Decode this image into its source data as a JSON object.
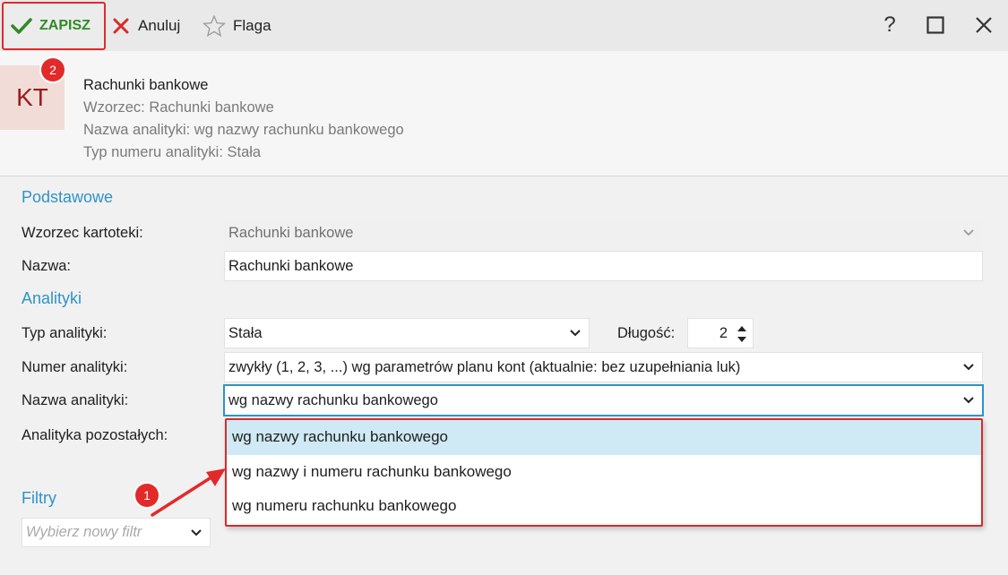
{
  "toolbar": {
    "save_label": "ZAPISZ",
    "cancel_label": "Anuluj",
    "flag_label": "Flaga",
    "help_label": "?"
  },
  "header": {
    "icon_text": "KT",
    "badge": "2",
    "title": "Rachunki bankowe",
    "template": "Wzorzec: Rachunki bankowe",
    "analytics_name": "Nazwa analityki: wg nazwy rachunku bankowego",
    "analytics_number_type": "Typ numeru analityki: Stała"
  },
  "sections": {
    "basic": "Podstawowe",
    "analytics": "Analityki",
    "filters": "Filtry"
  },
  "form": {
    "template_label": "Wzorzec kartoteki:",
    "template_value": "Rachunki bankowe",
    "name_label": "Nazwa:",
    "name_value": "Rachunki bankowe",
    "analytics_type_label": "Typ analityki:",
    "analytics_type_value": "Stała",
    "length_label": "Długość:",
    "length_value": "2",
    "analytics_number_label": "Numer analityki:",
    "analytics_number_value": "zwykły (1, 2, 3, ...) wg parametrów planu kont (aktualnie: bez uzupełniania luk)",
    "analytics_name_label": "Nazwa analityki:",
    "analytics_name_value": "wg nazwy rachunku bankowego",
    "other_analytics_label": "Analityka pozostałych:"
  },
  "dropdown": {
    "options": [
      "wg nazwy rachunku bankowego",
      "wg nazwy i numeru rachunku bankowego",
      "wg numeru rachunku bankowego"
    ]
  },
  "annotation": {
    "badge": "1"
  },
  "filter": {
    "placeholder": "Wybierz nowy filtr"
  },
  "colors": {
    "accent": "#2f93c6",
    "save_green": "#2f8a28",
    "highlight_red": "#e02a2a",
    "selected_option": "#cfe9f5"
  }
}
